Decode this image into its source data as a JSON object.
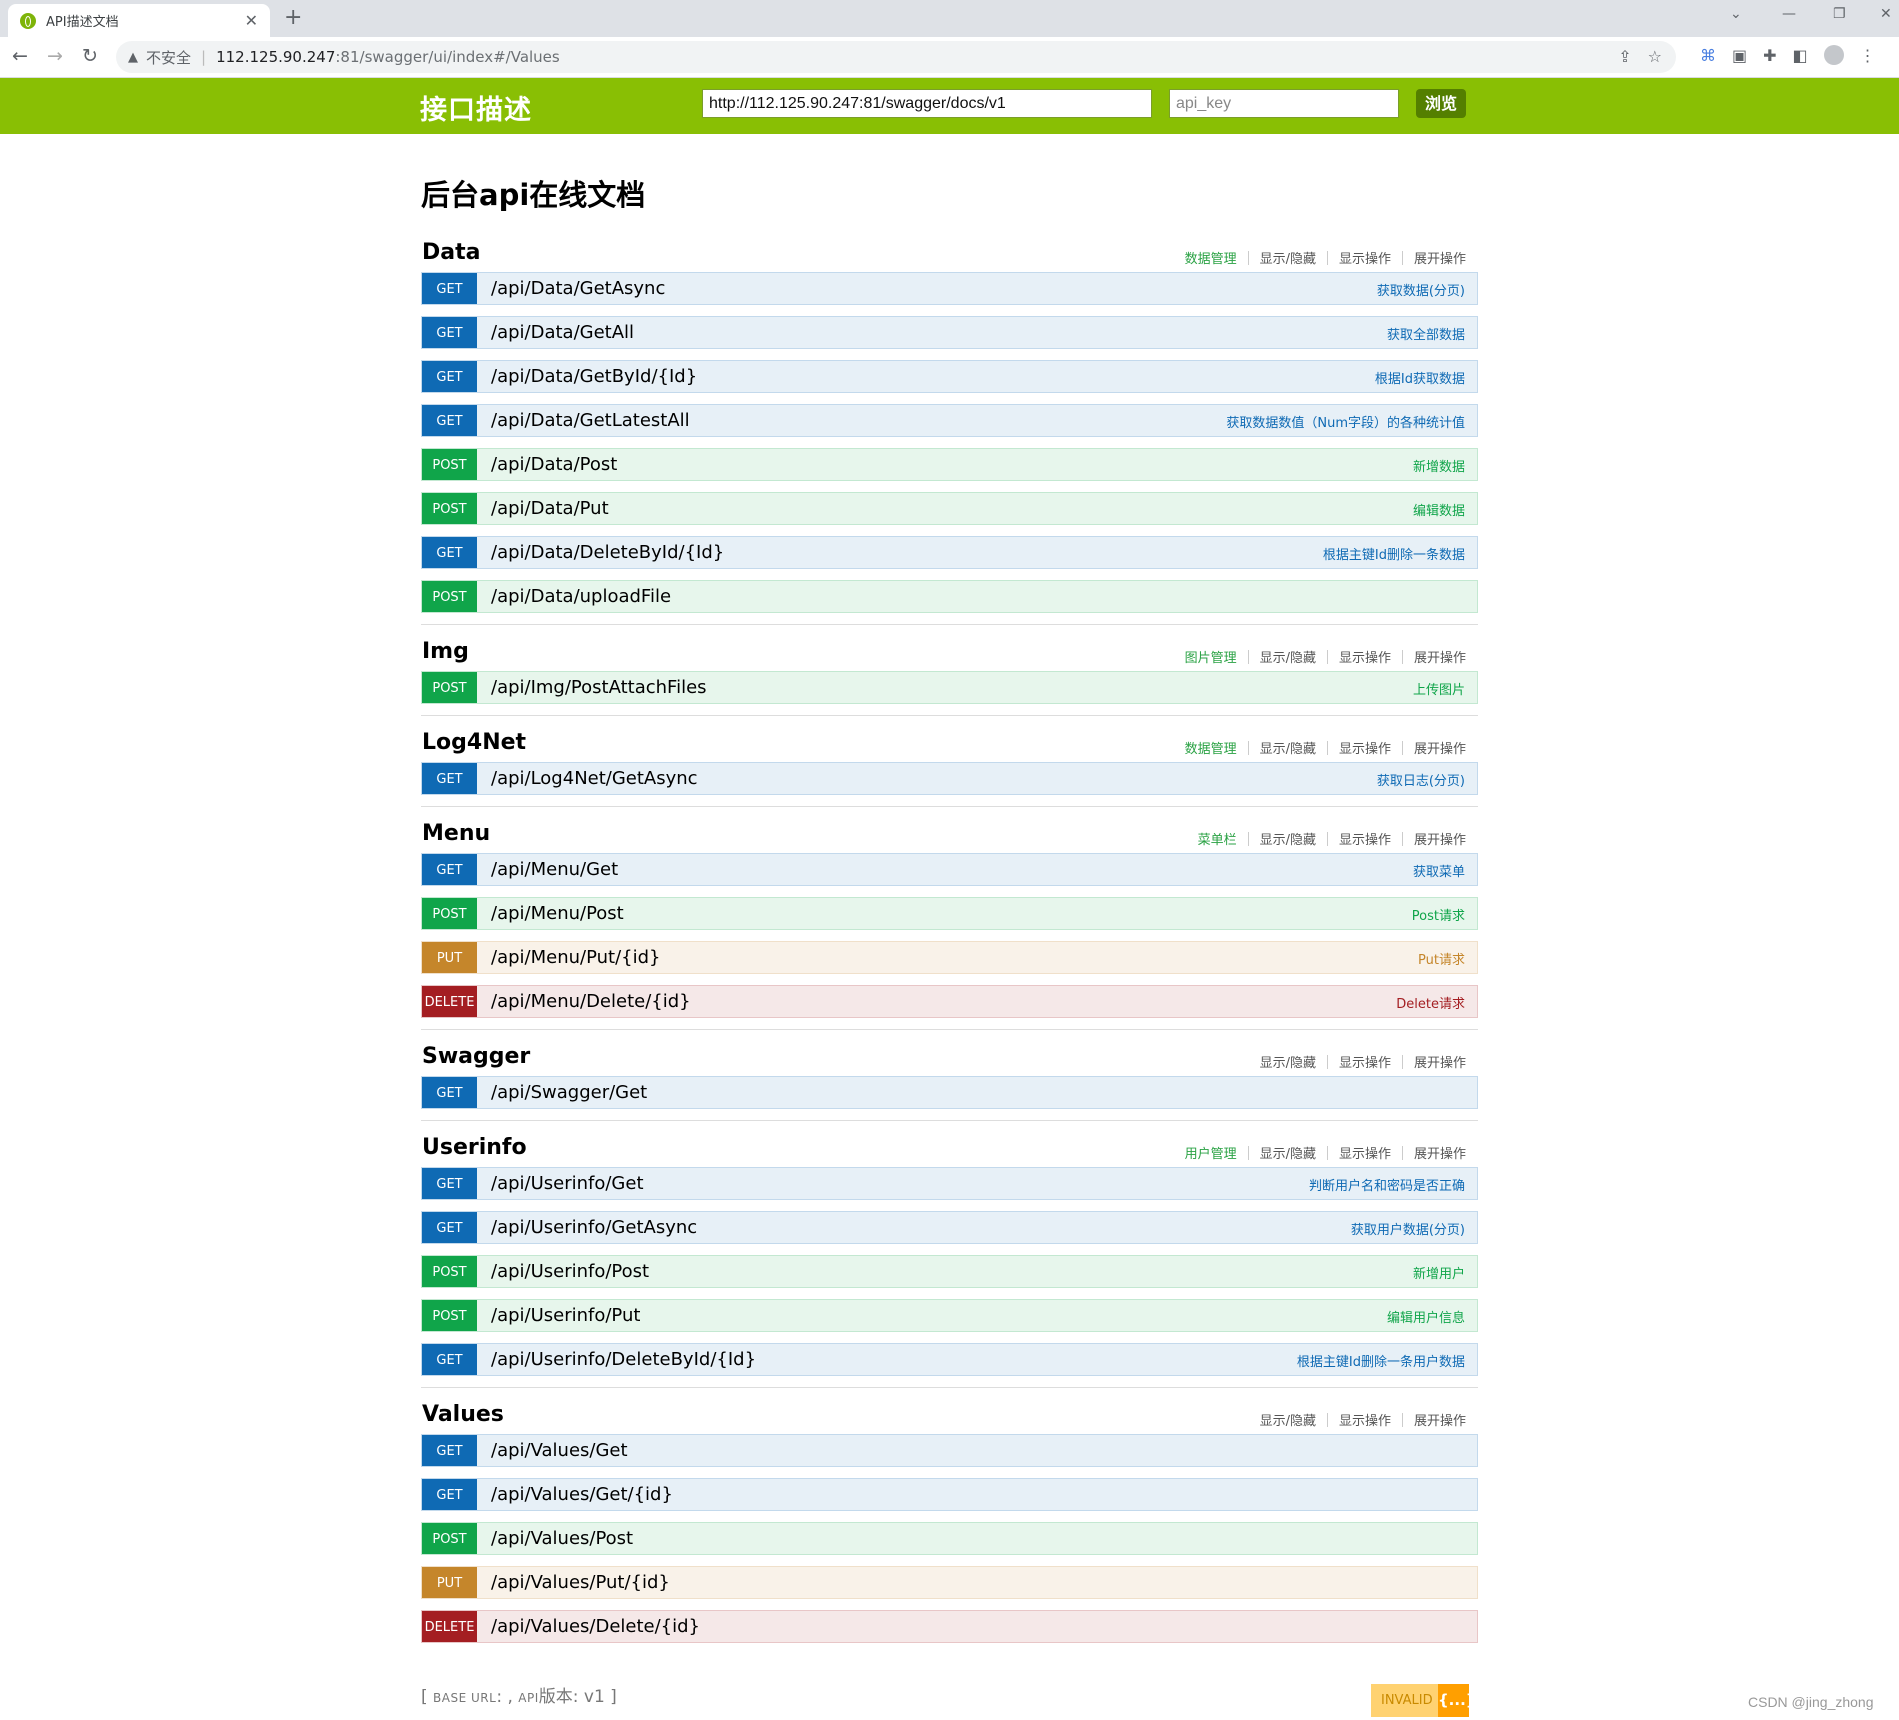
{
  "browser": {
    "tab_title": "API描述文档",
    "tab_close": "✕",
    "new_tab": "+",
    "insecure_label": "不安全",
    "url_host": "112.125.90.247",
    "url_path": ":81/swagger/ui/index#/Values",
    "window_controls": [
      "⌄",
      "—",
      "❐",
      "✕"
    ]
  },
  "header": {
    "logo": "接口描述",
    "url_value": "http://112.125.90.247:81/swagger/docs/v1",
    "api_key_placeholder": "api_key",
    "explore": "浏览"
  },
  "page_title": "后台api在线文档",
  "links": {
    "toggle": "显示/隐藏",
    "list": "显示操作",
    "expand": "展开操作"
  },
  "resources": [
    {
      "name": "Data",
      "description": "数据管理",
      "operations": [
        {
          "method": "GET",
          "path": "/api/Data/GetAsync",
          "summary": "获取数据(分页)"
        },
        {
          "method": "GET",
          "path": "/api/Data/GetAll",
          "summary": "获取全部数据"
        },
        {
          "method": "GET",
          "path": "/api/Data/GetById/{Id}",
          "summary": "根据Id获取数据"
        },
        {
          "method": "GET",
          "path": "/api/Data/GetLatestAll",
          "summary": "获取数据数值（Num字段）的各种统计值"
        },
        {
          "method": "POST",
          "path": "/api/Data/Post",
          "summary": "新增数据"
        },
        {
          "method": "POST",
          "path": "/api/Data/Put",
          "summary": "编辑数据"
        },
        {
          "method": "GET",
          "path": "/api/Data/DeleteById/{Id}",
          "summary": "根据主键Id删除一条数据"
        },
        {
          "method": "POST",
          "path": "/api/Data/uploadFile",
          "summary": ""
        }
      ]
    },
    {
      "name": "Img",
      "description": "图片管理",
      "operations": [
        {
          "method": "POST",
          "path": "/api/Img/PostAttachFiles",
          "summary": "上传图片"
        }
      ]
    },
    {
      "name": "Log4Net",
      "description": "数据管理",
      "operations": [
        {
          "method": "GET",
          "path": "/api/Log4Net/GetAsync",
          "summary": "获取日志(分页)"
        }
      ]
    },
    {
      "name": "Menu",
      "description": "菜单栏",
      "operations": [
        {
          "method": "GET",
          "path": "/api/Menu/Get",
          "summary": "获取菜单"
        },
        {
          "method": "POST",
          "path": "/api/Menu/Post",
          "summary": "Post请求"
        },
        {
          "method": "PUT",
          "path": "/api/Menu/Put/{id}",
          "summary": "Put请求"
        },
        {
          "method": "DELETE",
          "path": "/api/Menu/Delete/{id}",
          "summary": "Delete请求"
        }
      ]
    },
    {
      "name": "Swagger",
      "description": "",
      "operations": [
        {
          "method": "GET",
          "path": "/api/Swagger/Get",
          "summary": ""
        }
      ]
    },
    {
      "name": "Userinfo",
      "description": "用户管理",
      "operations": [
        {
          "method": "GET",
          "path": "/api/Userinfo/Get",
          "summary": "判断用户名和密码是否正确"
        },
        {
          "method": "GET",
          "path": "/api/Userinfo/GetAsync",
          "summary": "获取用户数据(分页)"
        },
        {
          "method": "POST",
          "path": "/api/Userinfo/Post",
          "summary": "新增用户"
        },
        {
          "method": "POST",
          "path": "/api/Userinfo/Put",
          "summary": "编辑用户信息"
        },
        {
          "method": "GET",
          "path": "/api/Userinfo/DeleteById/{Id}",
          "summary": "根据主键Id删除一条用户数据"
        }
      ]
    },
    {
      "name": "Values",
      "description": "",
      "operations": [
        {
          "method": "GET",
          "path": "/api/Values/Get",
          "summary": ""
        },
        {
          "method": "GET",
          "path": "/api/Values/Get/{id}",
          "summary": ""
        },
        {
          "method": "POST",
          "path": "/api/Values/Post",
          "summary": ""
        },
        {
          "method": "PUT",
          "path": "/api/Values/Put/{id}",
          "summary": ""
        },
        {
          "method": "DELETE",
          "path": "/api/Values/Delete/{id}",
          "summary": ""
        }
      ]
    }
  ],
  "footer": {
    "open_bracket": "[",
    "base_url_label": "BASE URL",
    "base_url_value": ":",
    "sep": ",",
    "api_label": "API",
    "api_version_label": "版本",
    "api_version_value": ": v1",
    "close_bracket": "]"
  },
  "validator": {
    "label": "INVALID",
    "icon": "{...}"
  },
  "watermark": "CSDN @jing_zhong",
  "colors": {
    "header_bg": "#89bf04",
    "get": "#0f6ab4",
    "post": "#10a54a",
    "put": "#c5862b",
    "delete": "#a41e22"
  }
}
